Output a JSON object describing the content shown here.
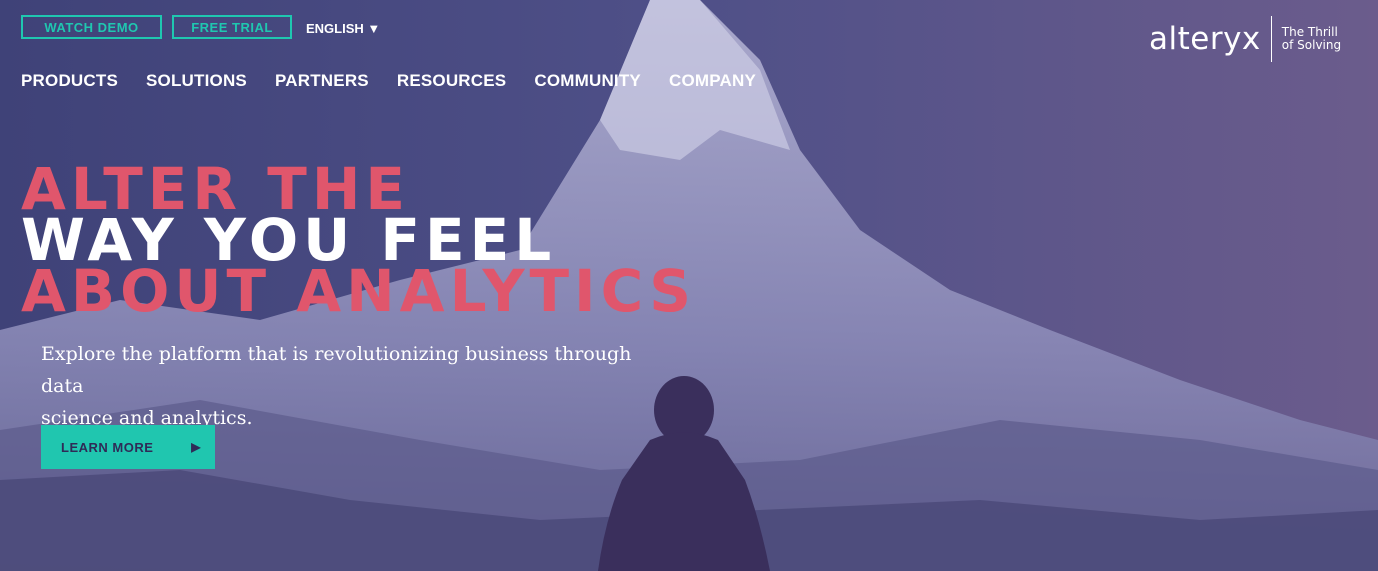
{
  "top_bar": {
    "watch_demo": "WATCH DEMO",
    "free_trial": "FREE TRIAL",
    "language": "ENGLISH",
    "language_icon": "caret-down"
  },
  "nav": {
    "items": [
      "PRODUCTS",
      "SOLUTIONS",
      "PARTNERS",
      "RESOURCES",
      "COMMUNITY",
      "COMPANY"
    ]
  },
  "logo": {
    "wordmark": "alteryx",
    "tagline_line1": "The Thrill",
    "tagline_line2": "of Solving"
  },
  "hero": {
    "line1": "ALTER THE",
    "line2": "WAY YOU FEEL",
    "line3": "ABOUT ANALYTICS",
    "subtitle_line1": "Explore the platform that is revolutionizing business through data",
    "subtitle_line2": "science and analytics.",
    "cta_label": "LEARN MORE",
    "cta_icon": "play-arrow"
  },
  "colors": {
    "accent_teal": "#1fc7b0",
    "headline_pink": "#e0566c",
    "overlay_purple": "#4a4a7e"
  }
}
